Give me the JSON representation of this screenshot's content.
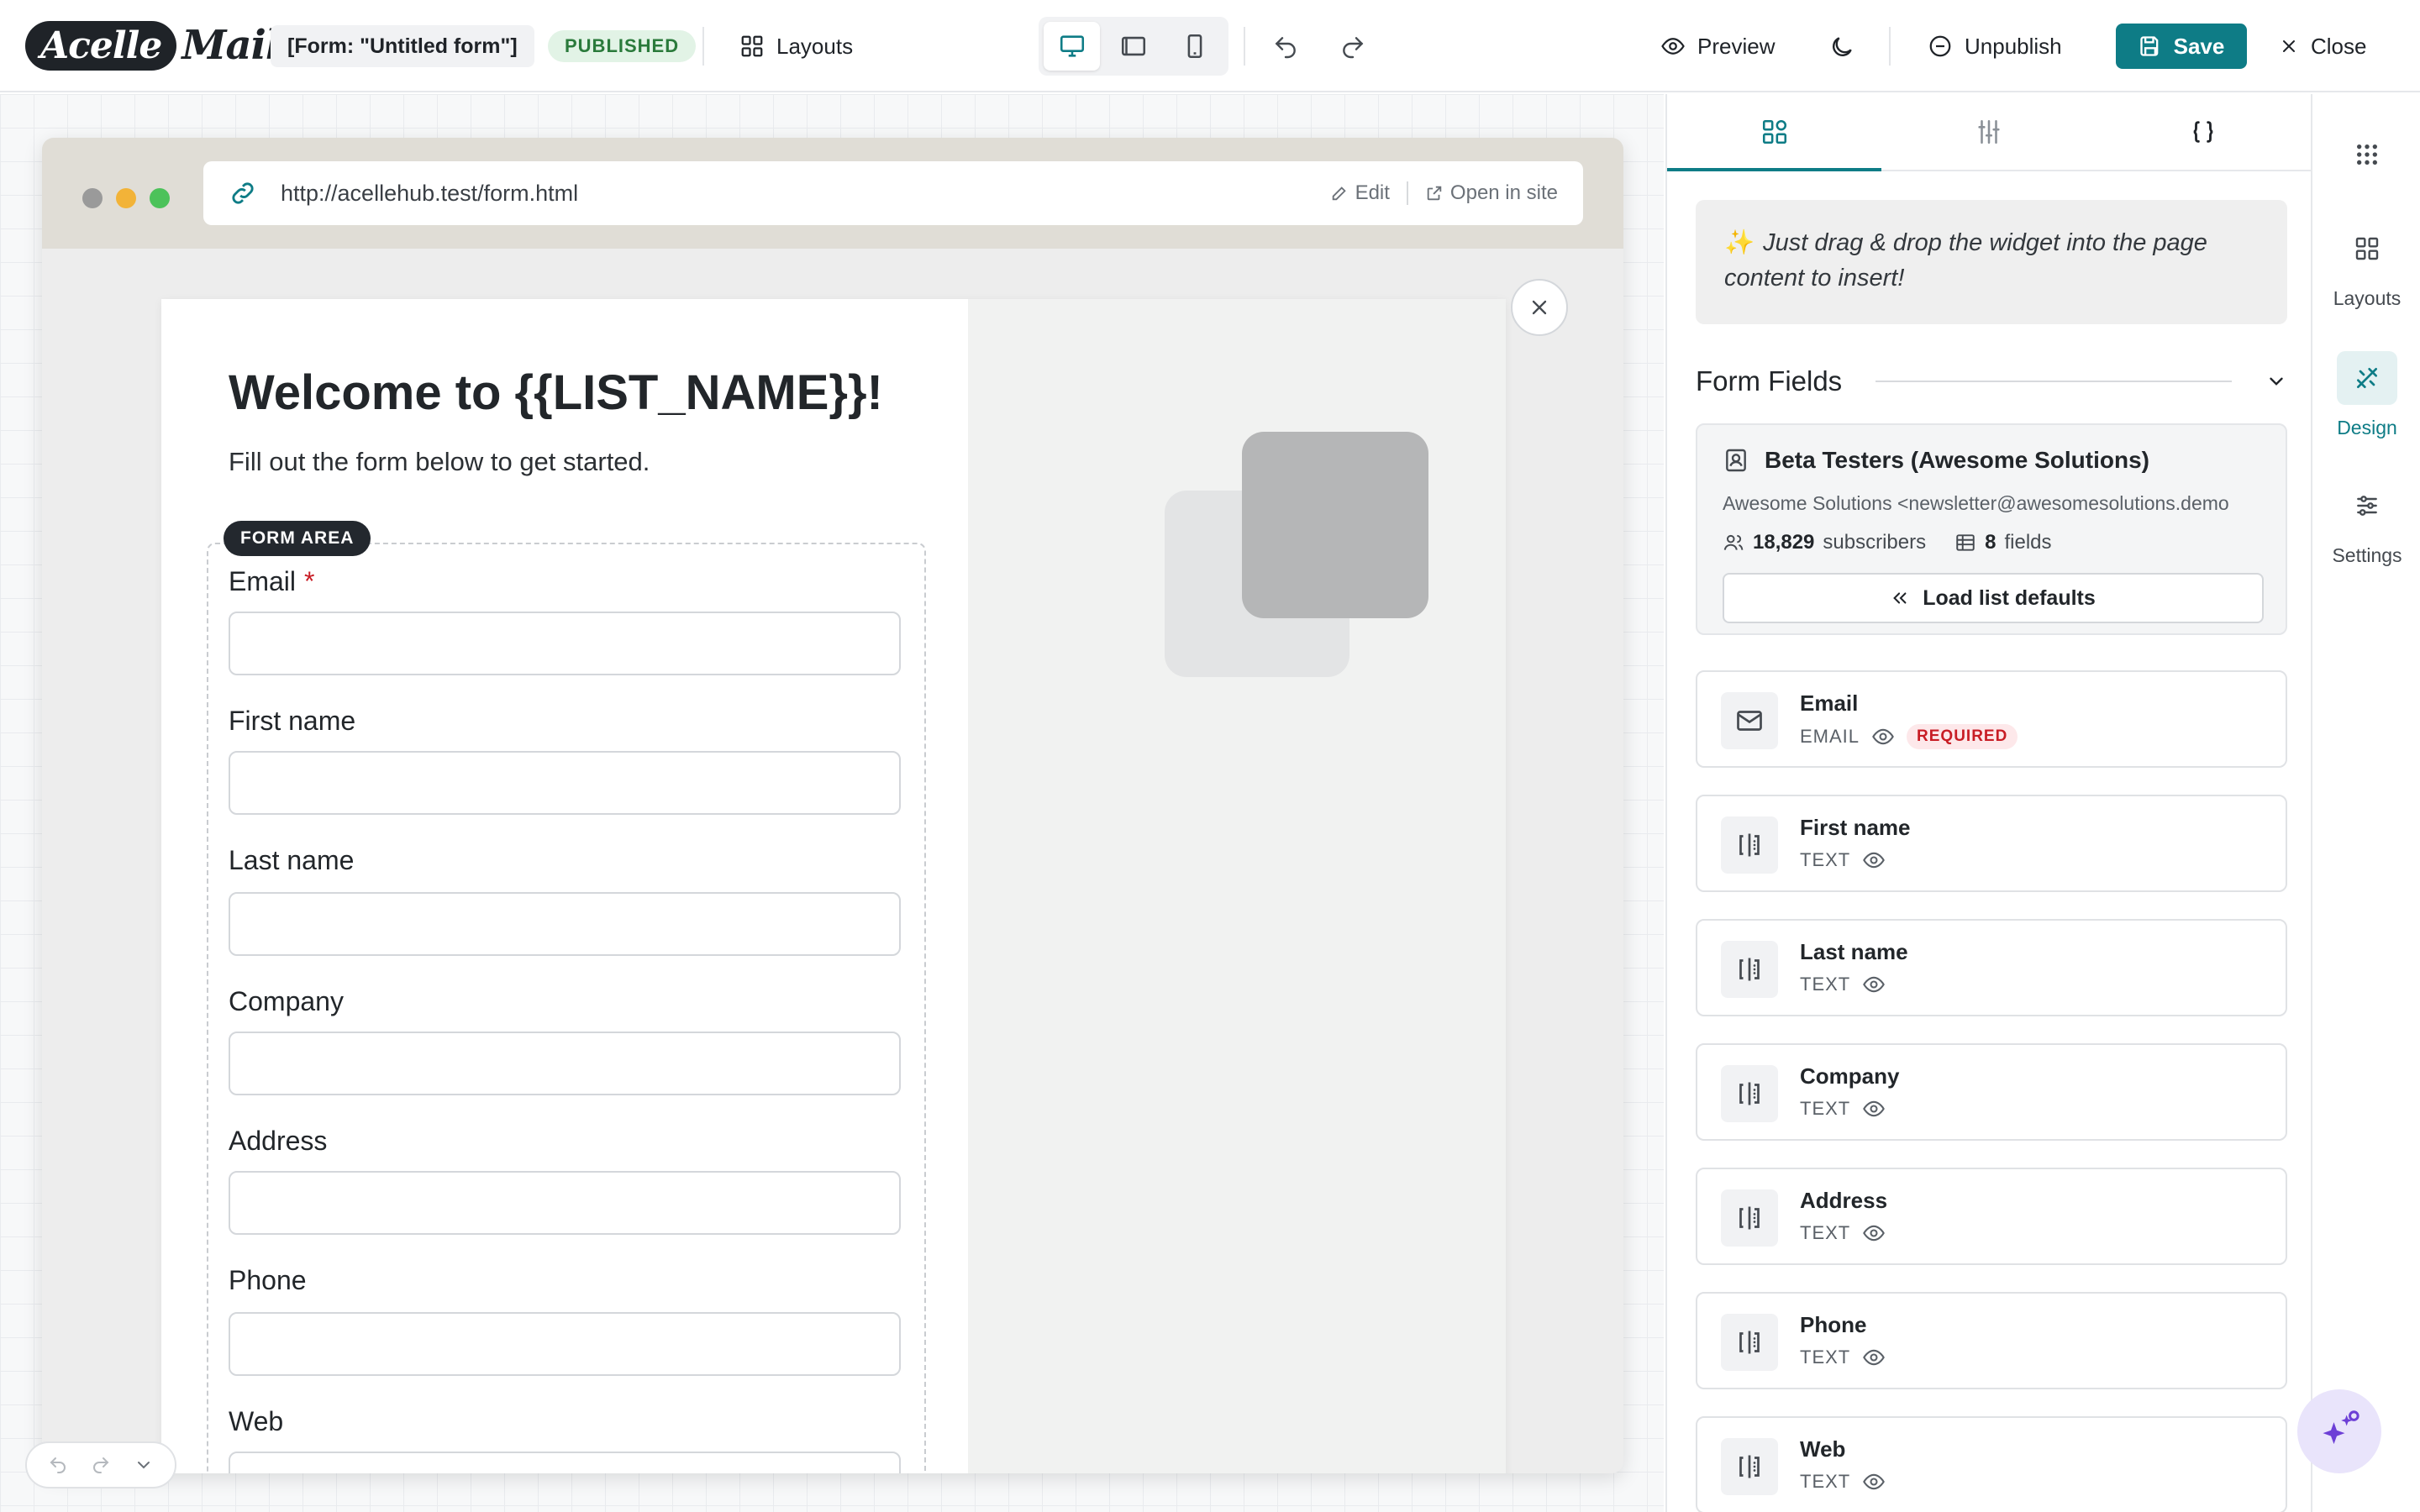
{
  "header": {
    "logo_part1": "Acelle",
    "logo_part2": "Mail",
    "form_name": "[Form: \"Untitled form\"]",
    "status": "PUBLISHED",
    "layouts_label": "Layouts",
    "preview_label": "Preview",
    "unpublish_label": "Unpublish",
    "save_label": "Save",
    "close_label": "Close",
    "device_active": "desktop"
  },
  "browser": {
    "url": "http://acellehub.test/form.html",
    "edit_label": "Edit",
    "open_label": "Open in site"
  },
  "popup": {
    "title": "Welcome to {{LIST_NAME}}!",
    "subtitle": "Fill out the form below to get started.",
    "form_area_tag": "FORM AREA",
    "required_mark": "*",
    "fields": [
      {
        "label": "Email"
      },
      {
        "label": "First name"
      },
      {
        "label": "Last name"
      },
      {
        "label": "Company"
      },
      {
        "label": "Address"
      },
      {
        "label": "Phone"
      },
      {
        "label": "Web"
      }
    ]
  },
  "panel": {
    "hint_icon": "✨",
    "hint": "Just drag & drop the widget into the page content to insert!",
    "form_fields_title": "Form Fields",
    "list": {
      "name": "Beta Testers (Awesome Solutions)",
      "email": "Awesome Solutions <newsletter@awesomesolutions.demo",
      "subscribers_count": "18,829",
      "subscribers_label": "subscribers",
      "fields_count": "8",
      "fields_label": "fields",
      "load_defaults_label": "Load list defaults"
    },
    "fields": [
      {
        "name": "Email",
        "type": "EMAIL",
        "badge": "REQUIRED"
      },
      {
        "name": "First name",
        "type": "TEXT"
      },
      {
        "name": "Last name",
        "type": "TEXT"
      },
      {
        "name": "Company",
        "type": "TEXT"
      },
      {
        "name": "Address",
        "type": "TEXT"
      },
      {
        "name": "Phone",
        "type": "TEXT"
      },
      {
        "name": "Web",
        "type": "TEXT"
      }
    ]
  },
  "rail": {
    "layouts_label": "Layouts",
    "design_label": "Design",
    "settings_label": "Settings",
    "active": "design"
  },
  "colors": {
    "accent": "#0e7c86",
    "published_bg": "#e2f3e6",
    "required_red": "#c81d25"
  }
}
